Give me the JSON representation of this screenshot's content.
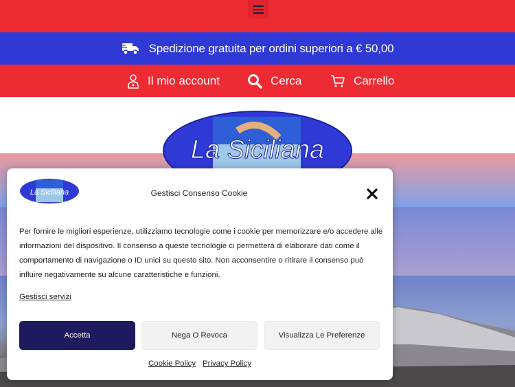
{
  "shipping_banner": {
    "text": "Spedizione gratuita per ordini superiori a € 50,00",
    "icon": "truck-icon"
  },
  "nav": {
    "account_label": "Il mio account",
    "search_label": "Cerca",
    "cart_label": "Carrello"
  },
  "logo_text": "La Siciliana",
  "cookie_dialog": {
    "title": "Gestisci Consenso Cookie",
    "body": "Per fornire le migliori esperienze, utilizziamo tecnologie come i cookie per memorizzare e/o accedere alle informazioni del dispositivo. Il consenso a queste tecnologie ci permetterà di elaborare dati come il comportamento di navigazione o ID unici su questo sito. Non acconsentire o ritirare il consenso può influire negativamente su alcune caratteristiche e funzioni.",
    "manage_services": "Gestisci servizi",
    "accept": "Accetta",
    "deny": "Nega O Revoca",
    "preferences": "Visualizza Le Preferenze",
    "cookie_policy": "Cookie Policy",
    "privacy_policy": "Privacy Policy"
  },
  "colors": {
    "red": "#ee2a33",
    "blue": "#2f3ad6",
    "accept_button": "#1e1a5e"
  }
}
